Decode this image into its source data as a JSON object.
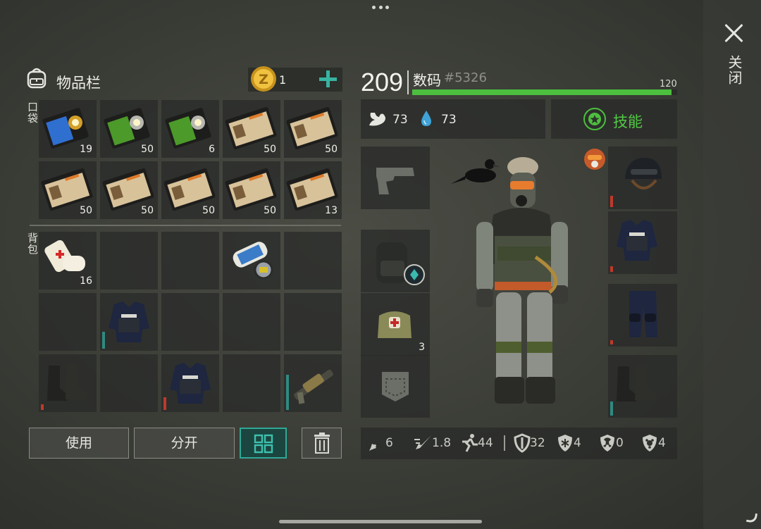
{
  "window": {
    "close_label": "关闭"
  },
  "inventory": {
    "title": "物品栏",
    "coins": "1",
    "pocket_label": "口袋",
    "backpack_label": "背包",
    "pocket_slots": [
      {
        "item": "police-badge-blue",
        "qty": "19"
      },
      {
        "item": "police-badge-green",
        "qty": "50"
      },
      {
        "item": "police-badge-green",
        "qty": "6"
      },
      {
        "item": "police-patrol-id-card",
        "qty": "50"
      },
      {
        "item": "police-patrol-id-card",
        "qty": "50"
      },
      {
        "item": "police-patrol-id-card",
        "qty": "50"
      },
      {
        "item": "police-patrol-id-card",
        "qty": "50"
      },
      {
        "item": "police-patrol-id-card",
        "qty": "50"
      },
      {
        "item": "police-patrol-id-card",
        "qty": "50"
      },
      {
        "item": "police-patrol-id-card",
        "qty": "13"
      }
    ],
    "backpack_slots": [
      {
        "item": "bandage",
        "qty": "16"
      },
      {
        "item": "",
        "qty": ""
      },
      {
        "item": "",
        "qty": ""
      },
      {
        "item": "police-blueprint-scroll",
        "qty": ""
      },
      {
        "item": "",
        "qty": ""
      },
      {
        "item": "",
        "qty": ""
      },
      {
        "item": "police-swat-vest",
        "qty": ""
      },
      {
        "item": "",
        "qty": ""
      },
      {
        "item": "",
        "qty": ""
      },
      {
        "item": "",
        "qty": ""
      },
      {
        "item": "combat-boots",
        "qty": ""
      },
      {
        "item": "",
        "qty": ""
      },
      {
        "item": "police-swat-vest",
        "qty": ""
      },
      {
        "item": "",
        "qty": ""
      },
      {
        "item": "grenade-launcher",
        "qty": ""
      }
    ],
    "buttons": {
      "use": "使用",
      "split": "分开"
    }
  },
  "character": {
    "level": "209",
    "name": "数码",
    "id": "#5326",
    "hp": "120",
    "hp_fraction": 0.98,
    "food": "73",
    "water": "73",
    "skills_label": "技能",
    "left_slots": [
      {
        "item": "pistol-placeholder",
        "qty": ""
      },
      {
        "item": "backpack",
        "qty": ""
      },
      {
        "item": "medkit-bag",
        "qty": "3"
      },
      {
        "item": "pocket-placeholder",
        "qty": ""
      }
    ],
    "right_slots": [
      {
        "item": "swat-helmet"
      },
      {
        "item": "police-swat-vest"
      },
      {
        "item": "police-pants"
      },
      {
        "item": "combat-boots"
      }
    ],
    "stats": {
      "damage": "6",
      "attack_speed": "1.8",
      "speed": "44",
      "armor": "32",
      "cold": "4",
      "radiation": "0",
      "infection": "4"
    }
  },
  "colors": {
    "accent": "#38b3a2",
    "health": "#4cbf3e",
    "skill": "#52c944"
  }
}
